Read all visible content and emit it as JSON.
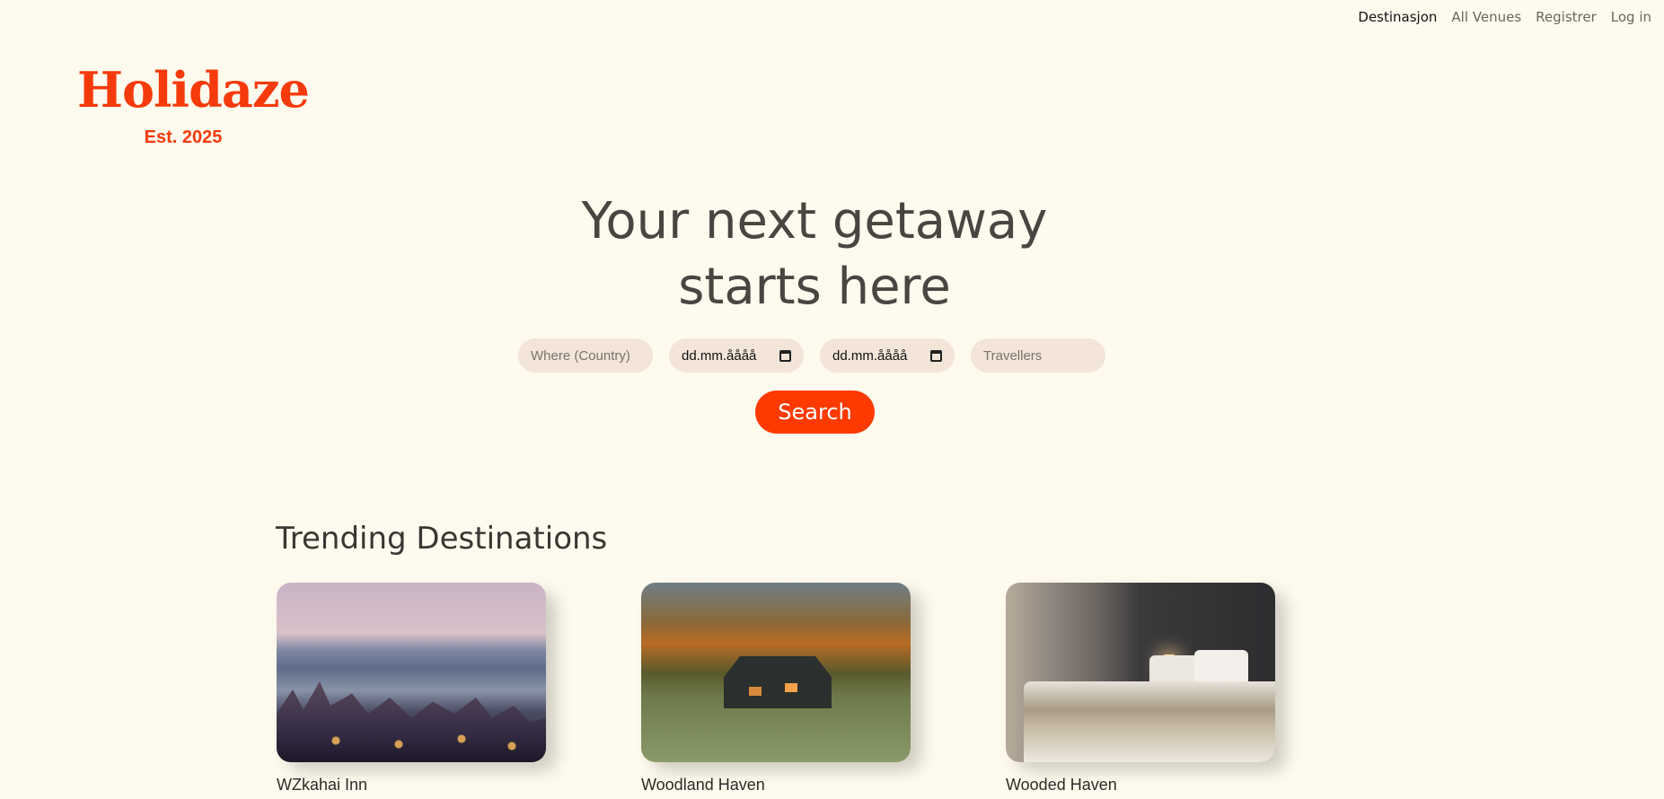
{
  "nav": {
    "items": [
      {
        "label": "Destinasjon",
        "active": true
      },
      {
        "label": "All Venues",
        "active": false
      },
      {
        "label": "Registrer",
        "active": false
      },
      {
        "label": "Log in",
        "active": false
      }
    ]
  },
  "brand": {
    "name": "Holidaze",
    "tagline": "Est. 2025",
    "color": "#f53a0c"
  },
  "hero": {
    "line1": "Your next getaway",
    "line2": "starts here"
  },
  "search": {
    "where_placeholder": "Where (Country)",
    "checkin_value": "dd.mm.åååå",
    "checkout_value": "dd.mm.åååå",
    "travellers_placeholder": "Travellers",
    "button_label": "Search",
    "button_color": "#fe3a00"
  },
  "trending": {
    "heading": "Trending Destinations",
    "cards": [
      {
        "title": "WZkahai Inn"
      },
      {
        "title": "Woodland Haven"
      },
      {
        "title": "Wooded Haven"
      }
    ]
  }
}
